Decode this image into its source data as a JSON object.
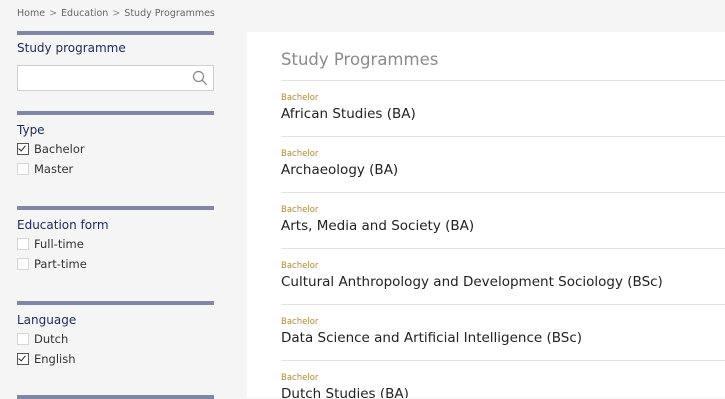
{
  "breadcrumb": {
    "items": [
      "Home",
      "Education",
      "Study Programmes"
    ],
    "separator": ">"
  },
  "sidebar": {
    "search": {
      "title": "Study programme",
      "value": "",
      "placeholder": "",
      "icon": "search-icon"
    },
    "facets": [
      {
        "title": "Type",
        "options": [
          {
            "label": "Bachelor",
            "checked": true
          },
          {
            "label": "Master",
            "checked": false
          }
        ]
      },
      {
        "title": "Education form",
        "options": [
          {
            "label": "Full-time",
            "checked": false
          },
          {
            "label": "Part-time",
            "checked": false
          }
        ]
      },
      {
        "title": "Language",
        "options": [
          {
            "label": "Dutch",
            "checked": false
          },
          {
            "label": "English",
            "checked": true
          }
        ]
      }
    ]
  },
  "main": {
    "title": "Study Programmes",
    "programmes": [
      {
        "level": "Bachelor",
        "name": "African Studies (BA)"
      },
      {
        "level": "Bachelor",
        "name": "Archaeology (BA)"
      },
      {
        "level": "Bachelor",
        "name": "Arts, Media and Society (BA)"
      },
      {
        "level": "Bachelor",
        "name": "Cultural Anthropology and Development Sociology (BSc)"
      },
      {
        "level": "Bachelor",
        "name": "Data Science and Artificial Intelligence (BSc)"
      },
      {
        "level": "Bachelor",
        "name": "Dutch Studies (BA)"
      }
    ]
  },
  "colors": {
    "facet_bar": "#8087a2",
    "heading": "#1d2a5c",
    "level_label": "#b08a3e",
    "background": "#f5f5f5"
  }
}
